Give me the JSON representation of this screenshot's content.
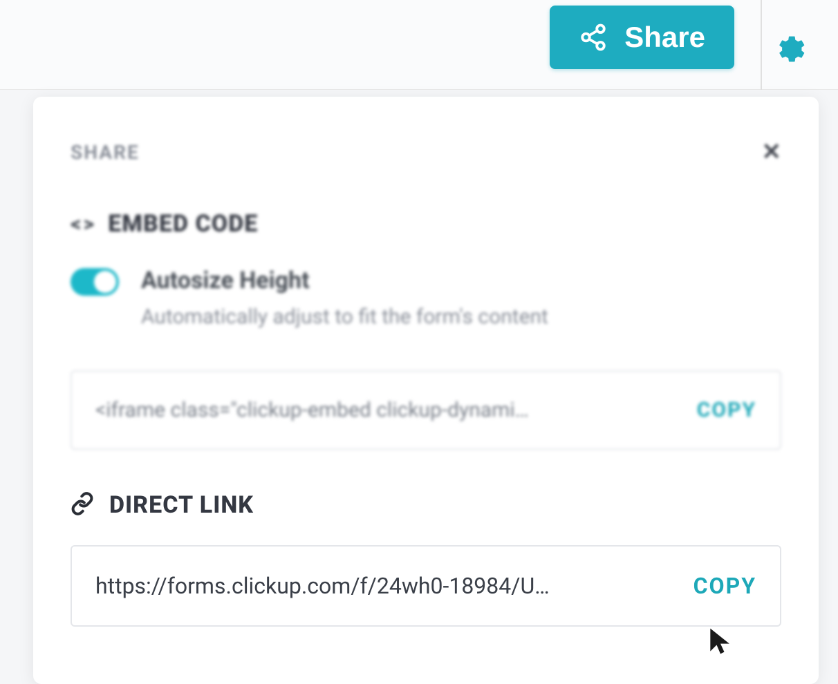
{
  "header": {
    "share_button_label": "Share"
  },
  "panel": {
    "title": "SHARE",
    "embed": {
      "section_label": "EMBED CODE",
      "toggle_label": "Autosize Height",
      "toggle_description": "Automatically adjust to fit the form's content",
      "toggle_state": true,
      "code_preview": "<iframe class=\"clickup-embed clickup-dynami…",
      "copy_label": "COPY"
    },
    "direct_link": {
      "section_label": "DIRECT LINK",
      "url_preview": "https://forms.clickup.com/f/24wh0-18984/U…",
      "copy_label": "COPY"
    }
  }
}
